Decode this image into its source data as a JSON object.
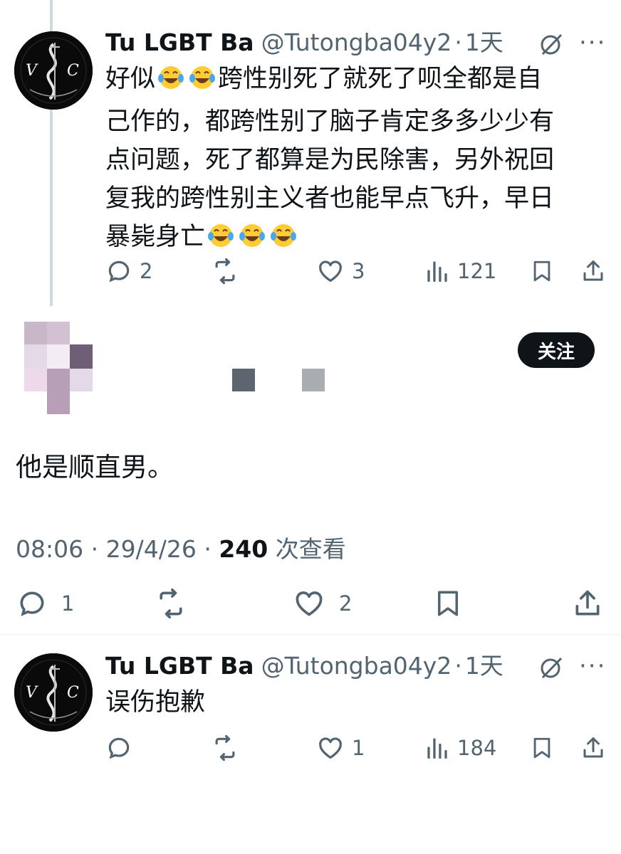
{
  "reply1": {
    "name": "Tu LGBT Ba",
    "handle": "@Tutongba04y2",
    "sep": "·",
    "time": "1天",
    "text_lines": [
      "好似",
      "跨性别死了就死了呗全都是自",
      "己作的，都跨性别了脑子肯定多多少少有",
      "点问题，死了都算是为民除害，另外祝回",
      "复我的跨性别主义者也能早点飞升，早日",
      "暴毙身亡"
    ],
    "emoji": "tears-of-joy",
    "replies": "2",
    "likes": "3",
    "views": "121"
  },
  "main_tweet": {
    "follow_label": "关注",
    "text": "他是顺直男。",
    "time": "08:06",
    "sep1": "·",
    "date": "29/4/26",
    "sep2": "·",
    "views_count": "240",
    "views_label": "次查看",
    "replies": "1",
    "likes": "2",
    "blur_colors": [
      "#c8b6c9",
      "#d4c0d3",
      "#e4d9e6",
      "#6f5f76",
      "#edd9ea",
      "#b89fb8",
      "#f3ecf4",
      "#5d6670",
      "#a9adb2"
    ]
  },
  "reply2": {
    "name": "Tu LGBT Ba",
    "handle": "@Tutongba04y2",
    "sep": "·",
    "time": "1天",
    "text": "误伤抱歉",
    "likes": "1",
    "views": "184"
  },
  "colors": {
    "text": "#0f1419",
    "secondary": "#536471",
    "thread_line": "#cfd9de",
    "button_bg": "#0f1419"
  }
}
